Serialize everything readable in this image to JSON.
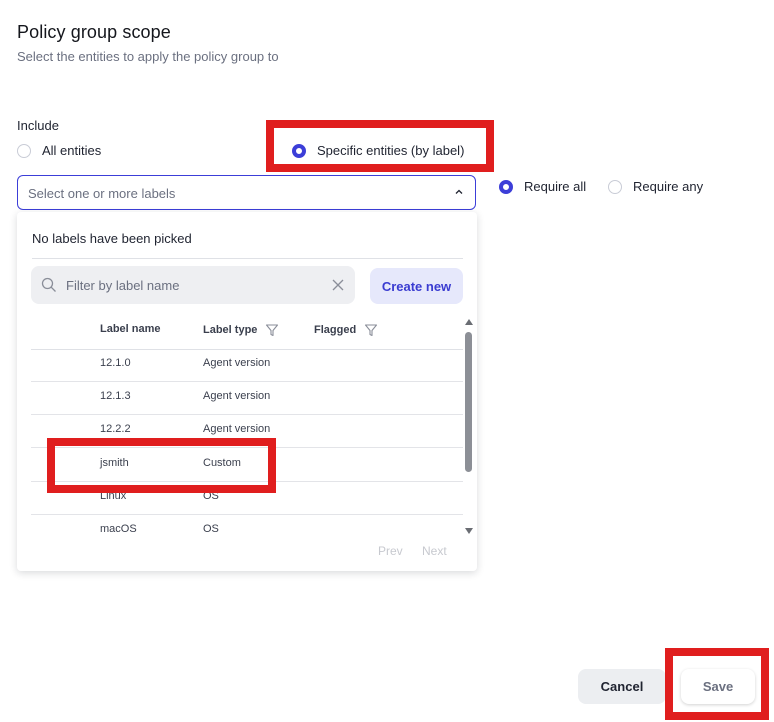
{
  "header": {
    "title": "Policy group scope",
    "subtitle": "Select the entities to apply the policy group to"
  },
  "include": {
    "label": "Include",
    "options": [
      {
        "label": "All entities",
        "selected": false
      },
      {
        "label": "Specific entities (by label)",
        "selected": true
      }
    ]
  },
  "label_select": {
    "placeholder": "Select one or more labels"
  },
  "match_mode": {
    "options": [
      {
        "label": "Require all",
        "selected": true
      },
      {
        "label": "Require any",
        "selected": false
      }
    ]
  },
  "dropdown": {
    "empty_message": "No labels have been picked",
    "filter_placeholder": "Filter by label name",
    "create_button": "Create new",
    "columns": [
      "Label name",
      "Label type",
      "Flagged"
    ],
    "rows": [
      {
        "name": "12.1.0",
        "type": "Agent version"
      },
      {
        "name": "12.1.3",
        "type": "Agent version"
      },
      {
        "name": "12.2.2",
        "type": "Agent version"
      },
      {
        "name": "jsmith",
        "type": "Custom"
      },
      {
        "name": "Linux",
        "type": "OS"
      },
      {
        "name": "macOS",
        "type": "OS"
      }
    ],
    "pager": {
      "prev": "Prev",
      "next": "Next"
    }
  },
  "footer": {
    "cancel": "Cancel",
    "save": "Save"
  },
  "colors": {
    "accent": "#3c3ed8",
    "highlight": "#e01e1e"
  }
}
